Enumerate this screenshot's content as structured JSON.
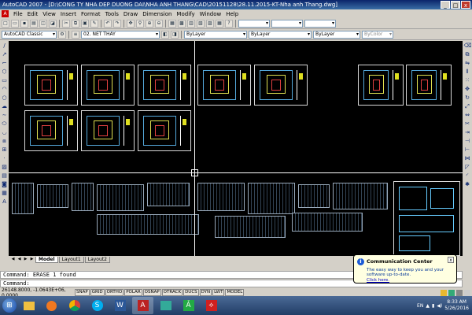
{
  "window": {
    "title": "AutoCAD 2007 - [D:\\CONG TY NHA DEP DUONG DAI\\NHA ANH THANG\\CAD\\20151128\\28.11.2015-KT-Nha anh Thang.dwg]",
    "controls": {
      "minimize": "_",
      "maximize": "□",
      "close": "x"
    }
  },
  "menu": [
    "File",
    "Edit",
    "View",
    "Insert",
    "Format",
    "Tools",
    "Draw",
    "Dimension",
    "Modify",
    "Window",
    "Help"
  ],
  "toolbar": {
    "workspace": "AutoCAD Classic",
    "layer": "02. NET THAY",
    "color": "ByLayer",
    "linetype": "ByLayer",
    "lineweight": "ByLayer",
    "plotstyle": "ByColor"
  },
  "layout_tabs": [
    "Model",
    "Layout1",
    "Layout2"
  ],
  "layout_nav": [
    "◀",
    "◀",
    "▶",
    "▶"
  ],
  "command_line": {
    "line1": "Command:  ERASE 1 found",
    "line2": "Command:"
  },
  "status": {
    "coordinates": "26148.8000, -1.0643E+06, 0.0000",
    "toggles": [
      "SNAP",
      "GRID",
      "ORTHO",
      "POLAR",
      "OSNAP",
      "OTRACK",
      "DUCS",
      "DYN",
      "LWT",
      "MODEL"
    ]
  },
  "balloon": {
    "title": "Communication Center",
    "message": "The easy way to keep you and your software up-to-date.",
    "link": "Click here.",
    "close": "x",
    "icon": "info-icon"
  },
  "taskbar": {
    "apps": [
      "explorer-icon",
      "media-player-icon",
      "chrome-icon",
      "skype-icon",
      "word-icon",
      "autocad-icon",
      "image-viewer-icon",
      "app-icon",
      "acrobat-icon"
    ],
    "tray": {
      "language": "EN",
      "time": "8:33 AM",
      "date": "5/26/2016"
    }
  }
}
